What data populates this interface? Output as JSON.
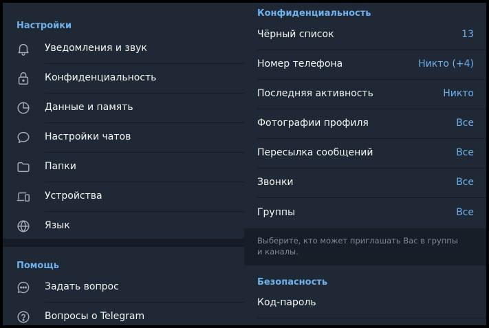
{
  "left": {
    "settings_header": "Настройки",
    "items": [
      {
        "label": "Уведомления и звук",
        "icon": "bell-icon"
      },
      {
        "label": "Конфиденциальность",
        "icon": "lock-icon"
      },
      {
        "label": "Данные и память",
        "icon": "pie-chart-icon"
      },
      {
        "label": "Настройки чатов",
        "icon": "chat-bubble-icon"
      },
      {
        "label": "Папки",
        "icon": "folder-icon"
      },
      {
        "label": "Устройства",
        "icon": "devices-icon"
      },
      {
        "label": "Язык",
        "icon": "globe-icon"
      }
    ],
    "help_header": "Помощь",
    "help_items": [
      {
        "label": "Задать вопрос",
        "icon": "chat-dots-icon"
      },
      {
        "label": "Вопросы о Telegram",
        "icon": "question-icon"
      }
    ]
  },
  "right": {
    "privacy_header": "Конфиденциальность",
    "items": [
      {
        "label": "Чёрный список",
        "value": "13"
      },
      {
        "label": "Номер телефона",
        "value": "Никто (+4)"
      },
      {
        "label": "Последняя активность",
        "value": "Никто"
      },
      {
        "label": "Фотографии профиля",
        "value": "Все"
      },
      {
        "label": "Пересылка сообщений",
        "value": "Все"
      },
      {
        "label": "Звонки",
        "value": "Все"
      },
      {
        "label": "Группы",
        "value": "Все"
      }
    ],
    "groups_hint": "Выберите, кто может приглашать Вас в группы и каналы.",
    "security_header": "Безопасность",
    "security_items": [
      {
        "label": "Код-пароль"
      }
    ]
  },
  "colors": {
    "accent": "#6fb0ea",
    "background": "#1f2936",
    "text": "#f5f5f5",
    "hint_text": "#7d8b99"
  }
}
